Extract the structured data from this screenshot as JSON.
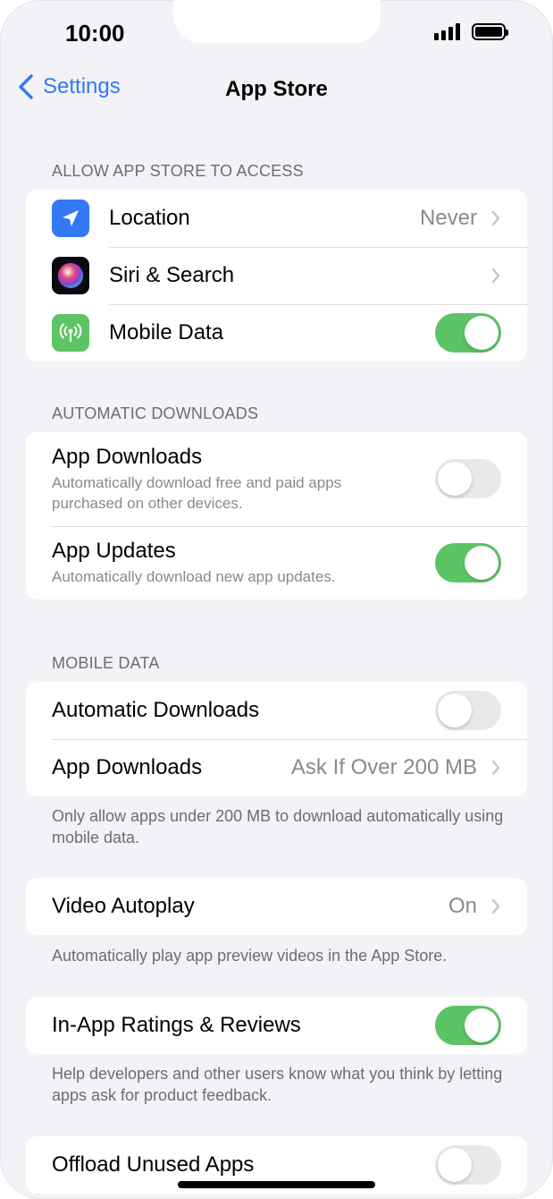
{
  "status_bar": {
    "time": "10:00"
  },
  "nav": {
    "back_label": "Settings",
    "title": "App Store"
  },
  "sections": {
    "access": {
      "header": "ALLOW APP STORE TO ACCESS",
      "location": {
        "label": "Location",
        "value": "Never",
        "icon": "location-arrow-icon",
        "icon_color": "#3478f6"
      },
      "siri": {
        "label": "Siri & Search",
        "icon": "siri-icon"
      },
      "mobile_data": {
        "label": "Mobile Data",
        "icon": "antenna-icon",
        "icon_color": "#5dc466",
        "enabled": true
      }
    },
    "auto_downloads": {
      "header": "AUTOMATIC DOWNLOADS",
      "app_downloads": {
        "label": "App Downloads",
        "sublabel": "Automatically download free and paid apps purchased on other devices.",
        "enabled": false
      },
      "app_updates": {
        "label": "App Updates",
        "sublabel": "Automatically download new app updates.",
        "enabled": true
      }
    },
    "mobile_data": {
      "header": "MOBILE DATA",
      "automatic_downloads": {
        "label": "Automatic Downloads",
        "enabled": false
      },
      "app_downloads": {
        "label": "App Downloads",
        "value": "Ask If Over 200 MB"
      },
      "footnote": "Only allow apps under 200 MB to download automatically using mobile data."
    },
    "video": {
      "autoplay": {
        "label": "Video Autoplay",
        "value": "On"
      },
      "footnote": "Automatically play app preview videos in the App Store."
    },
    "ratings": {
      "toggle": {
        "label": "In-App Ratings & Reviews",
        "enabled": true
      },
      "footnote": "Help developers and other users know what you think by letting apps ask for product feedback."
    },
    "offload": {
      "toggle": {
        "label": "Offload Unused Apps",
        "enabled": false
      }
    }
  },
  "colors": {
    "accent": "#3478f6",
    "toggle_on": "#5dc466",
    "background": "#f2f2f7"
  }
}
